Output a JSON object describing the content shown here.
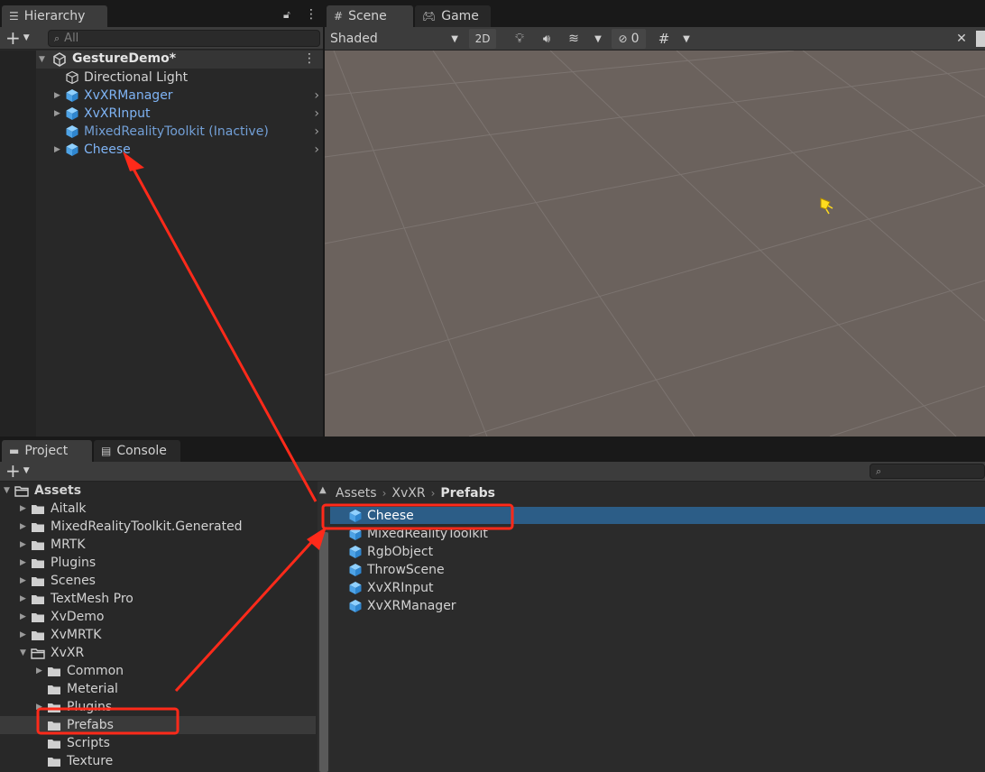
{
  "hierarchy": {
    "tab_label": "Hierarchy",
    "search_placeholder": "All",
    "scene_name": "GestureDemo*",
    "items": [
      {
        "label": "Directional Light",
        "style": "plain",
        "expandable": false
      },
      {
        "label": "XvXRManager",
        "style": "prefab",
        "expandable": true
      },
      {
        "label": "XvXRInput",
        "style": "prefab",
        "expandable": true
      },
      {
        "label": "MixedRealityToolkit (Inactive)",
        "style": "prefab",
        "expandable": false
      },
      {
        "label": "Cheese",
        "style": "prefab",
        "expandable": true
      }
    ]
  },
  "scene": {
    "tabs": [
      {
        "label": "Scene"
      },
      {
        "label": "Game"
      }
    ],
    "shading_mode": "Shaded",
    "toggle_2d": "2D",
    "hidden_count": "0"
  },
  "project": {
    "tabs": [
      {
        "label": "Project"
      },
      {
        "label": "Console"
      }
    ],
    "tree": [
      {
        "label": "Assets",
        "depth": 0,
        "open": true
      },
      {
        "label": "Aitalk",
        "depth": 1
      },
      {
        "label": "MixedRealityToolkit.Generated",
        "depth": 1
      },
      {
        "label": "MRTK",
        "depth": 1
      },
      {
        "label": "Plugins",
        "depth": 1
      },
      {
        "label": "Scenes",
        "depth": 1
      },
      {
        "label": "TextMesh Pro",
        "depth": 1
      },
      {
        "label": "XvDemo",
        "depth": 1
      },
      {
        "label": "XvMRTK",
        "depth": 1
      },
      {
        "label": "XvXR",
        "depth": 1,
        "open": true
      },
      {
        "label": "Common",
        "depth": 2
      },
      {
        "label": "Meterial",
        "depth": 2
      },
      {
        "label": "Plugins",
        "depth": 2
      },
      {
        "label": "Prefabs",
        "depth": 2,
        "selected": true
      },
      {
        "label": "Scripts",
        "depth": 2
      },
      {
        "label": "Texture",
        "depth": 2
      }
    ],
    "breadcrumb": [
      "Assets",
      "XvXR",
      "Prefabs"
    ],
    "assets": [
      {
        "label": "Cheese",
        "selected": true
      },
      {
        "label": "MixedRealityToolkit"
      },
      {
        "label": "RgbObject"
      },
      {
        "label": "ThrowScene"
      },
      {
        "label": "XvXRInput"
      },
      {
        "label": "XvXRManager"
      }
    ]
  },
  "colors": {
    "selection": "#2c5d87",
    "prefab_text": "#7fb4f5",
    "annotation": "#ff2a1a"
  }
}
